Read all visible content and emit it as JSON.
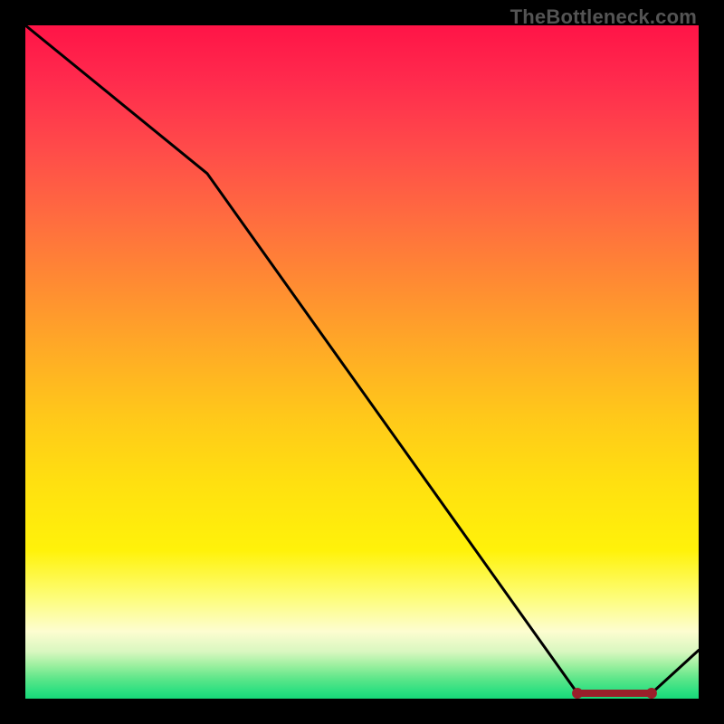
{
  "attribution": "TheBottleneck.com",
  "chart_data": {
    "type": "line",
    "x": [
      0,
      0.27,
      0.82,
      0.93,
      1.0
    ],
    "values": [
      1.0,
      0.78,
      0.008,
      0.008,
      0.072
    ],
    "title": "",
    "xlabel": "",
    "ylabel": "",
    "xlim": [
      0,
      1
    ],
    "ylim": [
      0,
      1
    ],
    "grid": false,
    "line_color": "#000000",
    "highlight": {
      "x_start": 0.82,
      "x_end": 0.93,
      "y": 0.008,
      "color": "#9a1f2a"
    }
  },
  "colors": {
    "frame": "#000000",
    "attribution_text": "#545454"
  }
}
